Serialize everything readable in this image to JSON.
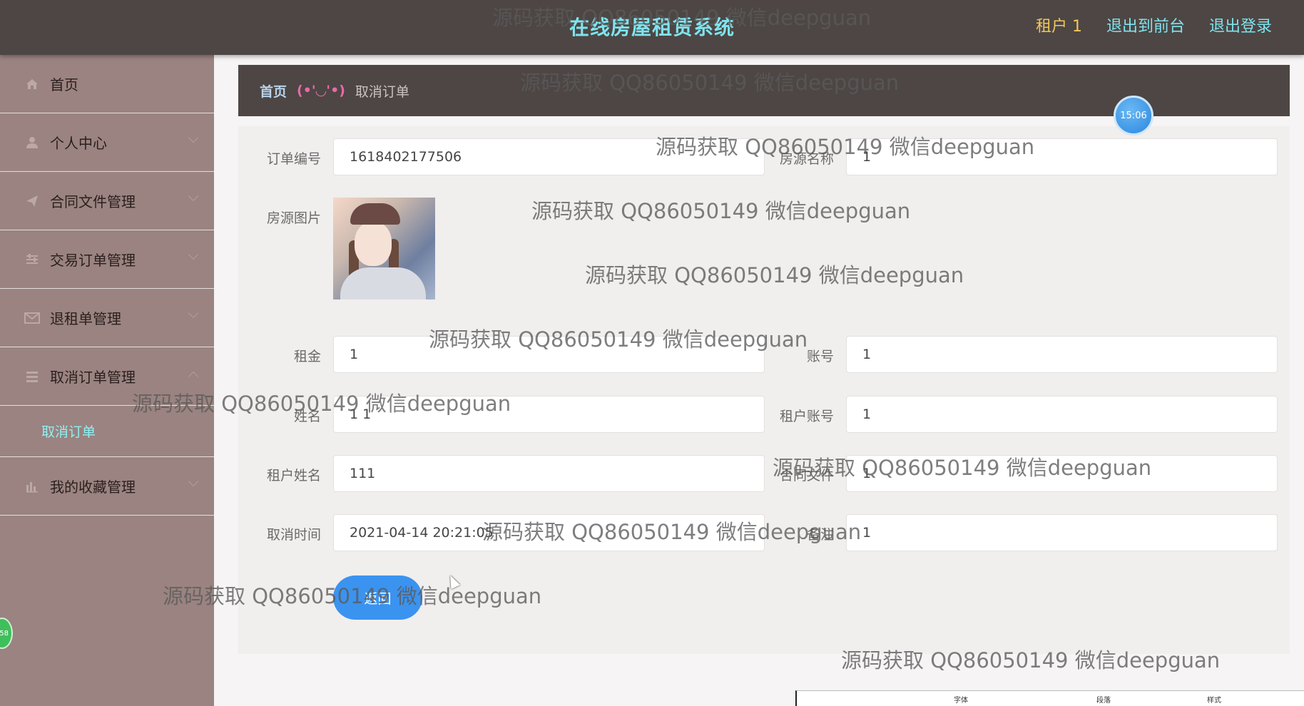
{
  "header": {
    "title": "在线房屋租赁系统",
    "user": "租户 1",
    "links": [
      "退出到前台",
      "退出登录"
    ]
  },
  "sidebar": {
    "items": [
      {
        "label": "首页",
        "icon": "home-icon"
      },
      {
        "label": "个人中心",
        "icon": "user-icon"
      },
      {
        "label": "合同文件管理",
        "icon": "send-icon"
      },
      {
        "label": "交易订单管理",
        "icon": "sliders-icon"
      },
      {
        "label": "退租单管理",
        "icon": "mail-icon"
      },
      {
        "label": "取消订单管理",
        "icon": "menu-icon"
      },
      {
        "label": "我的收藏管理",
        "icon": "chart-icon"
      }
    ],
    "subitem": "取消订单"
  },
  "breadcrumb": {
    "home": "首页",
    "separator": "(•'◡'•)",
    "current": "取消订单"
  },
  "clock": "15:06",
  "form": {
    "order_no_label": "订单编号",
    "order_no": "1618402177506",
    "house_name_label": "房源名称",
    "house_name": "1",
    "image_label": "房源图片",
    "rent_label": "租金",
    "rent": "1",
    "account_label": "账号",
    "account": "1",
    "name_label": "姓名",
    "name": "1 1",
    "tenant_account_label": "租户账号",
    "tenant_account": "1",
    "tenant_name_label": "租户姓名",
    "tenant_name": "111",
    "contract_label": "合同文件",
    "contract": "1",
    "cancel_time_label": "取消时间",
    "cancel_time": "2021-04-14 20:21:05",
    "remark_label": "备注",
    "remark": "1",
    "back_button": "返回"
  },
  "green_badge": "58",
  "bottom_strip": [
    "字体",
    "段落",
    "样式"
  ],
  "watermark": "源码获取 QQ86050149 微信deepguan",
  "colors": {
    "header_bg": "#4d4644",
    "title": "#7fe4ee",
    "user": "#f2c75c",
    "sidebar_bg": "#9a8380",
    "button": "#3b93f0"
  }
}
